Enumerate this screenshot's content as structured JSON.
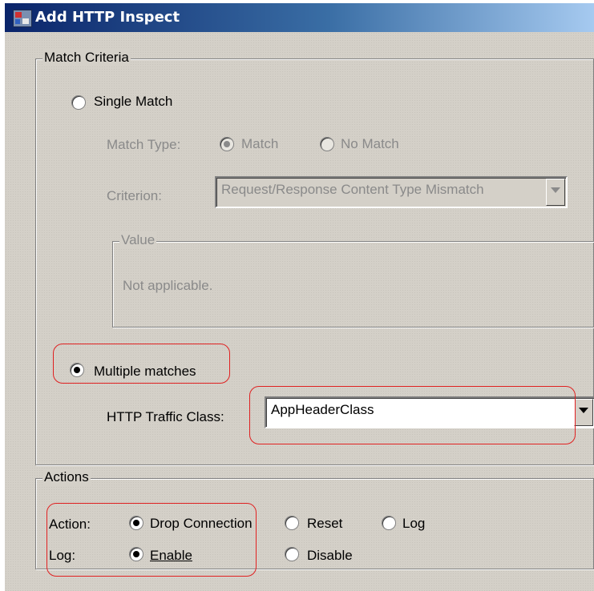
{
  "window": {
    "title": "Add HTTP Inspect"
  },
  "match_criteria": {
    "legend": "Match Criteria",
    "single_match_label": "Single Match",
    "single_match_selected": false,
    "match_type_label": "Match Type:",
    "match_option": "Match",
    "no_match_option": "No Match",
    "match_type_selected": "Match",
    "criterion_label": "Criterion:",
    "criterion_value": "Request/Response Content Type Mismatch",
    "value_legend": "Value",
    "value_text": "Not applicable.",
    "multiple_matches_label": "Multiple matches",
    "multiple_matches_selected": true,
    "traffic_class_label": "HTTP Traffic Class:",
    "traffic_class_value": "AppHeaderClass"
  },
  "actions": {
    "legend": "Actions",
    "action_label": "Action:",
    "drop_connection": "Drop Connection",
    "reset": "Reset",
    "log_option": "Log",
    "action_selected": "Drop Connection",
    "log_label": "Log:",
    "enable": "Enable",
    "disable": "Disable",
    "log_selected": "Enable"
  },
  "colors": {
    "dialog_bg": "#d4d0c8",
    "highlight": "#e02020",
    "titlebar": "#0a246a",
    "disabled_text": "#8a8a8a"
  }
}
